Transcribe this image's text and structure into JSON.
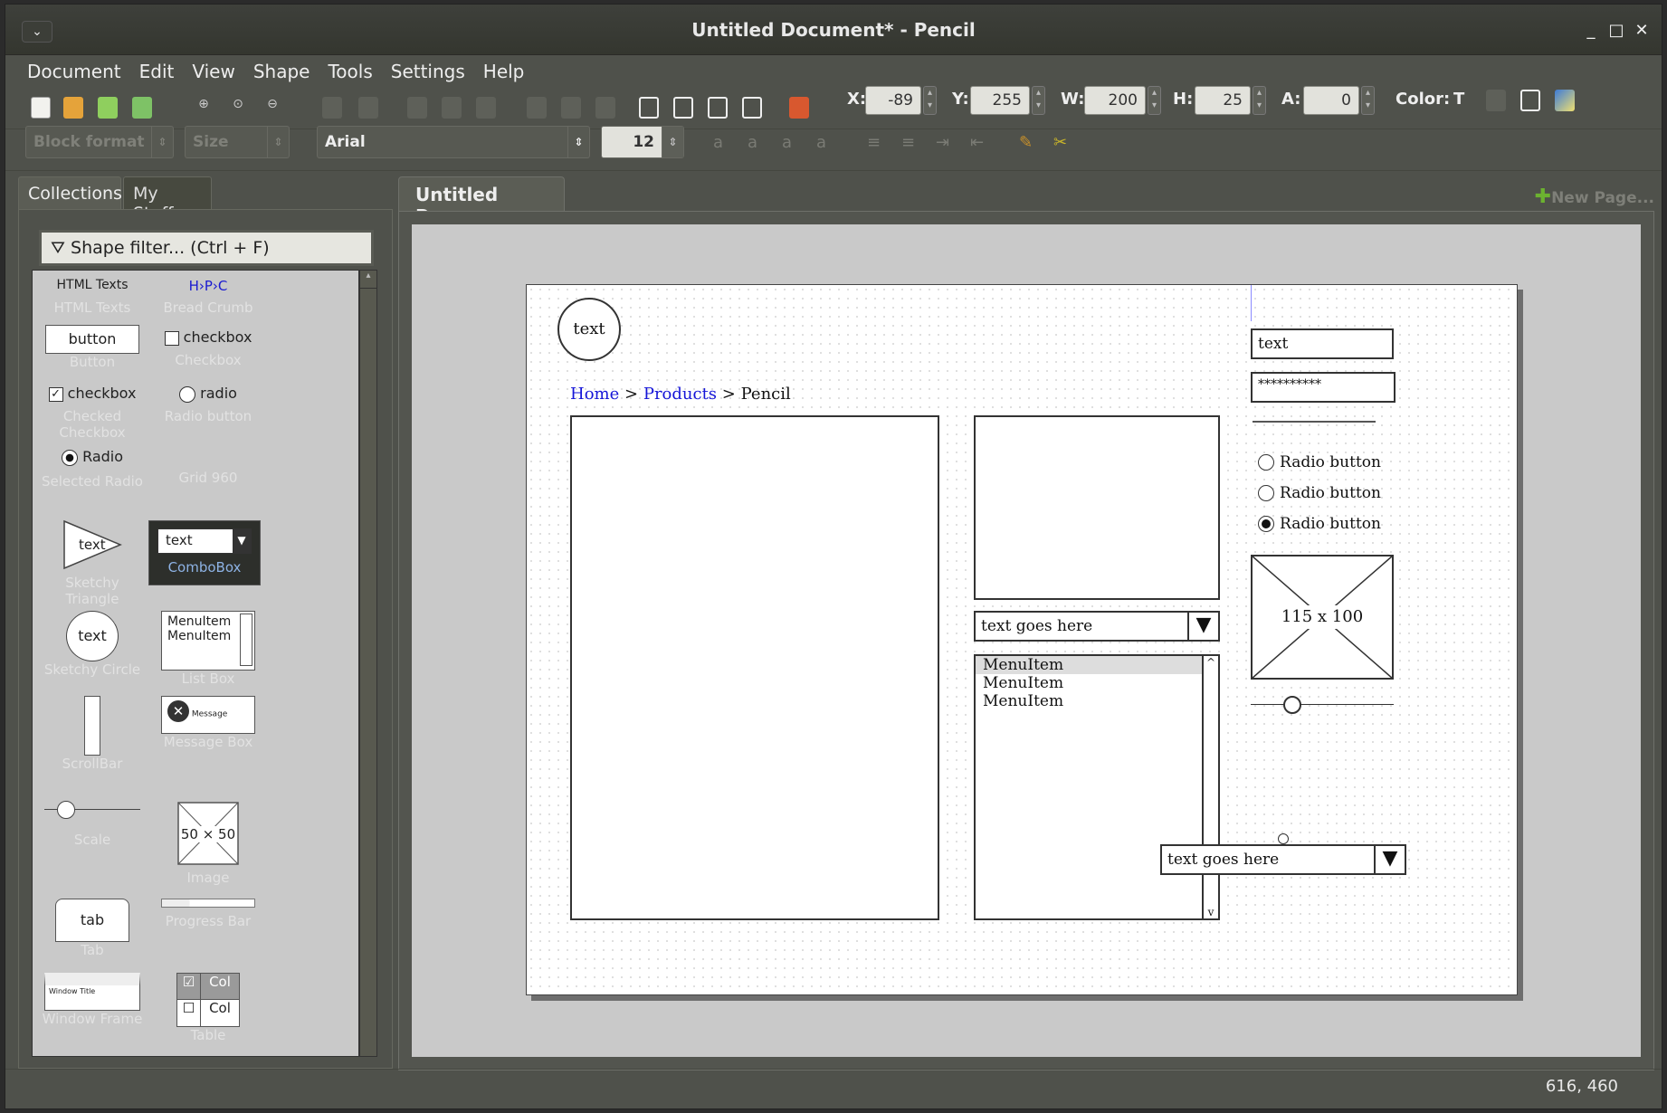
{
  "window": {
    "title": "Untitled Document* - Pencil",
    "minimize": "_",
    "maximize": "□",
    "close": "✕",
    "sysmenu": "⌄"
  },
  "menu": [
    "Document",
    "Edit",
    "View",
    "Shape",
    "Tools",
    "Settings",
    "Help"
  ],
  "geometry_toolbar": {
    "x_label": "X:",
    "x_value": "-89",
    "y_label": "Y:",
    "y_value": "255",
    "w_label": "W:",
    "w_value": "200",
    "h_label": "H:",
    "h_value": "25",
    "a_label": "A:",
    "a_value": "0",
    "color_label": "Color:"
  },
  "format_toolbar": {
    "block_format": "Block format",
    "size": "Size",
    "font": "Arial",
    "font_size": "12"
  },
  "left_tabs": [
    "Collections",
    "My Stuffs"
  ],
  "shape_filter": {
    "placeholder": "Shape filter... (Ctrl + F)"
  },
  "shapes": {
    "html_texts": {
      "preview": "HTML Texts",
      "label": "HTML Texts"
    },
    "breadcrumb": {
      "preview": "H›P›C",
      "label": "Bread Crumb"
    },
    "button": {
      "preview": "button",
      "label": "Button"
    },
    "checkbox": {
      "preview": "checkbox",
      "label": "Checkbox"
    },
    "checked_checkbox": {
      "preview": "checkbox",
      "label": "Checked Checkbox"
    },
    "radio": {
      "preview": "radio",
      "label": "Radio button"
    },
    "selected_radio": {
      "preview": "Radio",
      "label": "Selected Radio"
    },
    "grid": {
      "label": "Grid 960"
    },
    "triangle": {
      "preview": "text",
      "label": "Sketchy Triangle"
    },
    "combobox": {
      "preview": "text",
      "label": "ComboBox"
    },
    "circle": {
      "preview": "text",
      "label": "Sketchy Circle"
    },
    "listbox": {
      "item1": "MenuItem",
      "item2": "MenuItem",
      "label": "List Box"
    },
    "scrollbar": {
      "label": "ScrollBar"
    },
    "messagebox": {
      "preview": "Message",
      "label": "Message Box"
    },
    "scale": {
      "label": "Scale"
    },
    "image": {
      "preview": "50 × 50",
      "label": "Image"
    },
    "tab": {
      "preview": "tab",
      "label": "Tab"
    },
    "progress": {
      "label": "Progress Bar"
    },
    "window_frame": {
      "preview": "Window Title",
      "label": "Window Frame"
    },
    "table": {
      "col1": "Col",
      "col2": "Col",
      "label": "Table"
    }
  },
  "page_tab": "Untitled Page",
  "new_page": "New Page...",
  "canvas": {
    "circle_text": "text",
    "breadcrumb": {
      "home": "Home",
      "sep": ">",
      "products": "Products",
      "current": "Pencil"
    },
    "text_field": "text",
    "password_field": "**********",
    "radios": [
      {
        "label": "Radio button",
        "selected": false
      },
      {
        "label": "Radio button",
        "selected": false
      },
      {
        "label": "Radio button",
        "selected": true
      }
    ],
    "image_placeholder": "115 x 100",
    "combo1": "text goes here",
    "list_items": [
      "MenuItem",
      "MenuItem",
      "MenuItem"
    ],
    "combo2": "text goes here"
  },
  "status": {
    "coords": "616, 460"
  }
}
